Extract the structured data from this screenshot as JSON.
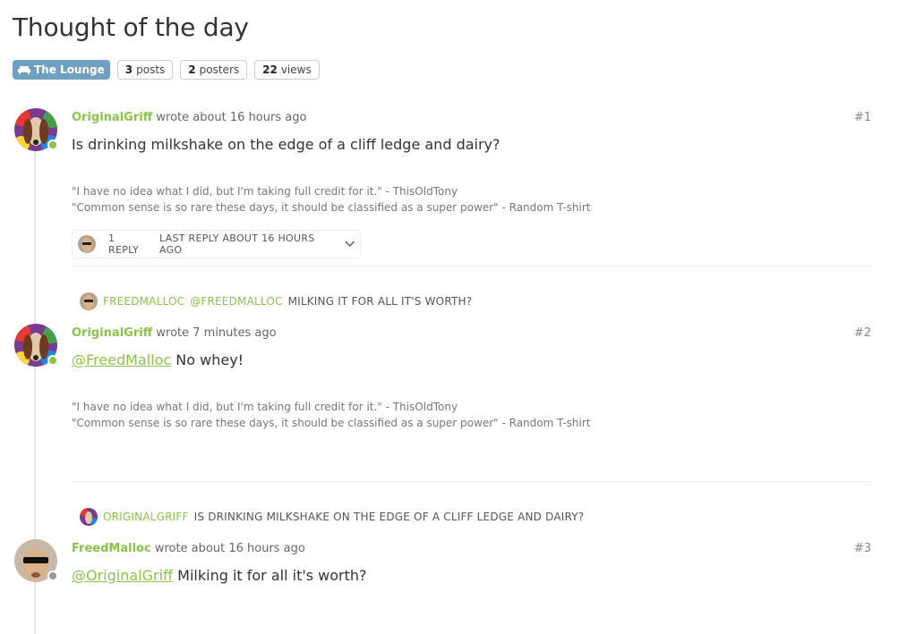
{
  "title": "Thought of the day",
  "tags": {
    "category": "The Lounge",
    "posts_count": "3",
    "posts_label": "posts",
    "posters_count": "2",
    "posters_label": "posters",
    "views_count": "22",
    "views_label": "views"
  },
  "signature": {
    "line1": "\"I have no idea what I did, but I'm taking full credit for it.\" - ThisOldTony",
    "line2": "\"Common sense is so rare these days, it should be classified as a super power\" - Random T-shirt"
  },
  "posts": [
    {
      "author": "OriginalGriff",
      "meta": "wrote about 16 hours ago",
      "index": "#1",
      "body": "Is drinking milkshake on the edge of a cliff ledge and dairy?",
      "replies": {
        "count_label": "1 REPLY",
        "last_reply": "LAST REPLY ABOUT 16 HOURS AGO"
      }
    },
    {
      "parent_author": "@FREEDMALLOC",
      "parent_author_name": "FREEDMALLOC",
      "parent_text": "MILKING IT FOR ALL IT'S WORTH?",
      "author": "OriginalGriff",
      "meta": "wrote 7 minutes ago",
      "index": "#2",
      "mention": "@FreedMalloc",
      "body": "No whey!"
    },
    {
      "parent_author_name": "ORIGINALGRIFF",
      "parent_text": "IS DRINKING MILKSHAKE ON THE EDGE OF A CLIFF LEDGE AND DAIRY?",
      "author": "FreedMalloc",
      "meta": "wrote about 16 hours ago",
      "index": "#3",
      "mention": "@OriginalGriff",
      "body": "Milking it for all it's worth?"
    }
  ],
  "colors": {
    "accent": "#8bc34a",
    "category": "#6fa0c0"
  }
}
